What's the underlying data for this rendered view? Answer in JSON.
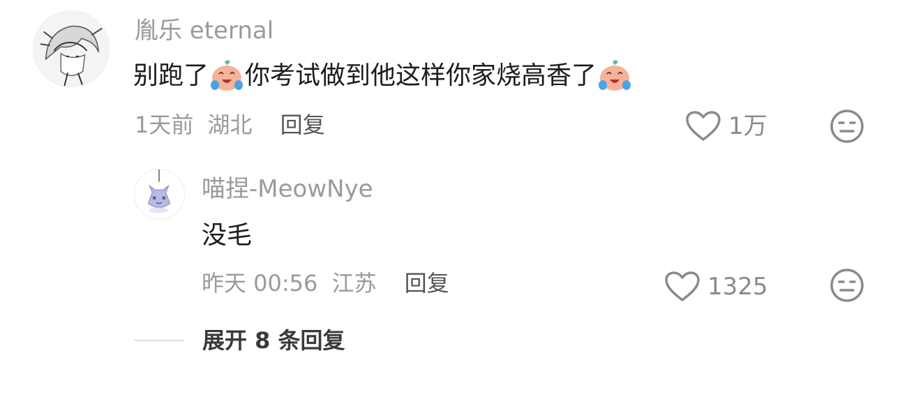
{
  "comments": [
    {
      "username": "胤乐 eternal",
      "text_parts": [
        "别跑了",
        "你考试做到他这样你家烧高香了"
      ],
      "emoji_icon": "crying-face-emoji",
      "date": "1天前",
      "location": "湖北",
      "reply_label": "回复",
      "likes": "1万",
      "dislike_icon": "neutral-face-icon"
    },
    {
      "username": "喵捏-MeowNye",
      "text": "没毛",
      "date": "昨天 00:56",
      "location": "江苏",
      "reply_label": "回复",
      "likes": "1325",
      "dislike_icon": "neutral-face-icon"
    }
  ],
  "expand_replies_label": "展开 8 条回复",
  "colors": {
    "username": "#9a9a9a",
    "meta": "#9a9a9a",
    "content": "#1c1c1c",
    "emoji_face": "#f6b39a",
    "emoji_leaf": "#5fbf8a",
    "emoji_tears": "#4aa3e8"
  }
}
